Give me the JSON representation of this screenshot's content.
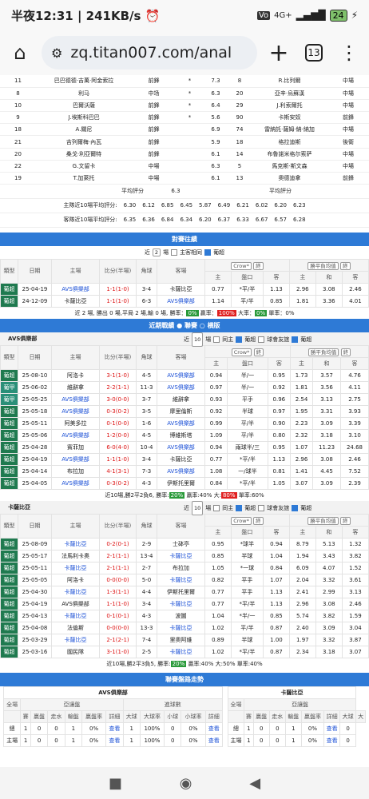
{
  "statusbar": {
    "time": "半夜12:31 | 241KB/s ⏰",
    "signal": "4G+",
    "battery": "24"
  },
  "browser": {
    "url": "zq.titan007.com/anal",
    "tab_count": "13"
  },
  "lineup": [
    [
      "11",
      "巴巴德德·吉萬·阿金索拉",
      "前鋒",
      "*",
      "7.3",
      "8",
      "R.比列爾",
      "中場"
    ],
    [
      "8",
      "利马",
      "中场",
      "*",
      "6.3",
      "20",
      "亞辛·烏蘇漢",
      "中場"
    ],
    [
      "10",
      "巴爾沃薩",
      "前鋒",
      "*",
      "6.4",
      "29",
      "J.利索爾托",
      "中場"
    ],
    [
      "9",
      "J.埃斯科巴巴",
      "前鋒",
      "*",
      "5.6",
      "90",
      "卡斯安奴",
      "前鋒"
    ],
    [
      "18",
      "A.關尼",
      "前鋒",
      "",
      "6.9",
      "74",
      "雷納託·薩姆·納·納加",
      "中場"
    ],
    [
      "21",
      "吉列爾梅·內瓦",
      "前鋒",
      "",
      "5.9",
      "18",
      "格拉迪斯",
      "後衛"
    ],
    [
      "20",
      "桑戈·利亞爾特",
      "前鋒",
      "",
      "6.1",
      "14",
      "布魯諾米格尔索萨",
      "中場"
    ],
    [
      "22",
      "G.文留卡",
      "中場",
      "",
      "6.3",
      "5",
      "馬克斯·斯文森",
      "中場"
    ],
    [
      "19",
      "T.加萊托",
      "中場",
      "",
      "6.1",
      "13",
      "奧德迪拿",
      "前鋒"
    ]
  ],
  "avg": {
    "label_left": "平均評分",
    "left_val": "6.3",
    "label_right": "平均評分",
    "home_label": "主隊近10場平均評分:",
    "home_vals": [
      "6.30",
      "6.12",
      "6.85",
      "6.45",
      "5.87",
      "6.49",
      "6.21",
      "6.02",
      "6.20",
      "6.23"
    ],
    "away_label": "客隊近10場平均評分:",
    "away_vals": [
      "6.35",
      "6.36",
      "6.84",
      "6.34",
      "6.20",
      "6.37",
      "6.33",
      "6.67",
      "6.57",
      "6.28"
    ]
  },
  "h2h": {
    "title": "對賽往績",
    "near": "近",
    "count": "2",
    "unit": "場",
    "same_home": "主客相同",
    "league": "葡超",
    "odds_company": "Crow*",
    "final": "終",
    "sub": "勝平負均值",
    "headers": [
      "類型",
      "日期",
      "主場",
      "比分(半場)",
      "角球",
      "客場",
      "主",
      "盤口",
      "客",
      "主",
      "和",
      "客"
    ],
    "rows": [
      [
        "葡超",
        "25-04-19",
        "AVS俱樂部",
        "1-1(1-0)",
        "3-4",
        "卡薩比亞",
        "0.77",
        "*平/半",
        "1.13",
        "2.96",
        "3.08",
        "2.46"
      ],
      [
        "葡超",
        "24-12-09",
        "卡薩比亞",
        "1-1(1-0)",
        "6-3",
        "AVS俱樂部",
        "1.14",
        "平/半",
        "0.85",
        "1.81",
        "3.36",
        "4.01"
      ]
    ],
    "summary_a": "近 2 場, 勝出 0 場,平局 2 場,輸 0 場, 勝率：",
    "win": "0%",
    "summary_b": "贏率：",
    "win2": "100%",
    "summary_c": "大率：",
    "win3": "0%",
    "summary_d": "單率：0%"
  },
  "recent": {
    "title": "近期戰績",
    "opt1": "聯賽",
    "opt2": "横版",
    "team1": "AVS俱樂部",
    "team1_near": "近",
    "team1_count": "10",
    "team1_unit": "場",
    "same": "同主",
    "league": "葡超",
    "cup": "球會友誼",
    "league2": "葡超",
    "headers": [
      "類型",
      "日期",
      "主場",
      "比分(半場)",
      "角球",
      "客場",
      "主",
      "盤口",
      "客",
      "主",
      "和",
      "客"
    ],
    "rows1": [
      [
        "葡超",
        "25-08-10",
        "阿洛卡",
        "3-1(1-0)",
        "4-5",
        "AVS俱樂部",
        "0.94",
        "半/一",
        "0.95",
        "1.73",
        "3.57",
        "4.76"
      ],
      [
        "葡甲",
        "25-06-02",
        "維辭拿",
        "2-2(1-1)",
        "11-3",
        "AVS俱樂部",
        "0.97",
        "半/一",
        "0.92",
        "1.81",
        "3.56",
        "4.11"
      ],
      [
        "葡甲",
        "25-05-25",
        "AVS俱樂部",
        "3-0(0-0)",
        "3-7",
        "維辭拿",
        "0.93",
        "平手",
        "0.96",
        "2.54",
        "3.13",
        "2.75"
      ],
      [
        "葡超",
        "25-05-18",
        "AVS俱樂部",
        "0-3(0-2)",
        "3-5",
        "摩里倫斯",
        "0.92",
        "半球",
        "0.97",
        "1.95",
        "3.31",
        "3.93"
      ],
      [
        "葡超",
        "25-05-11",
        "阿美多拉",
        "0-1(0-0)",
        "1-6",
        "AVS俱樂部",
        "0.99",
        "平/半",
        "0.90",
        "2.23",
        "3.09",
        "3.39"
      ],
      [
        "葡超",
        "25-05-06",
        "AVS俱樂部",
        "1-2(0-0)",
        "4-5",
        "博維斯塔",
        "1.09",
        "平/半",
        "0.80",
        "2.32",
        "3.18",
        "3.10"
      ],
      [
        "葡超",
        "25-04-28",
        "賓菲加",
        "6-0(4-0)",
        "10-4",
        "AVS俱樂部",
        "0.94",
        "兩球半/三",
        "0.95",
        "1.07",
        "11.23",
        "24.68"
      ],
      [
        "葡超",
        "25-04-19",
        "AVS俱樂部",
        "1-1(1-0)",
        "3-4",
        "卡薩比亞",
        "0.77",
        "*平/半",
        "1.13",
        "2.96",
        "3.08",
        "2.46"
      ],
      [
        "葡超",
        "25-04-14",
        "布拉加",
        "4-1(3-1)",
        "7-3",
        "AVS俱樂部",
        "1.08",
        "一/球半",
        "0.81",
        "1.41",
        "4.45",
        "7.52"
      ],
      [
        "葡超",
        "25-04-05",
        "AVS俱樂部",
        "0-3(0-2)",
        "4-3",
        "伊斯托里爾",
        "0.84",
        "*平/半",
        "1.05",
        "3.07",
        "3.09",
        "2.39"
      ]
    ],
    "summary1_a": "近10場,勝2平2負6, 勝率:",
    "summary1_win": "20%",
    "summary1_b": "贏率:40% 大:",
    "summary1_big": "80%",
    "summary1_c": "單率:60%",
    "team2": "卡薩比亞",
    "team2_near": "近",
    "team2_count": "10",
    "team2_unit": "場",
    "rows2": [
      [
        "葡超",
        "25-08-09",
        "卡薩比亞",
        "0-2(0-1)",
        "2-9",
        "士砵亭",
        "0.95",
        "*球半",
        "0.94",
        "8.79",
        "5.13",
        "1.32"
      ],
      [
        "葡超",
        "25-05-17",
        "法馬利卡奧",
        "2-1(1-1)",
        "13-4",
        "卡薩比亞",
        "0.85",
        "半球",
        "1.04",
        "1.94",
        "3.43",
        "3.82"
      ],
      [
        "葡超",
        "25-05-11",
        "卡薩比亞",
        "2-1(1-1)",
        "2-7",
        "布拉加",
        "1.05",
        "*一球",
        "0.84",
        "6.09",
        "4.07",
        "1.52"
      ],
      [
        "葡超",
        "25-05-05",
        "阿洛卡",
        "0-0(0-0)",
        "5-0",
        "卡薩比亞",
        "0.82",
        "平手",
        "1.07",
        "2.04",
        "3.32",
        "3.61"
      ],
      [
        "葡超",
        "25-04-30",
        "卡薩比亞",
        "1-3(1-1)",
        "4-4",
        "伊斯托里爾",
        "0.77",
        "平手",
        "1.13",
        "2.41",
        "2.99",
        "3.13"
      ],
      [
        "葡超",
        "25-04-19",
        "AVS俱樂部",
        "1-1(1-0)",
        "3-4",
        "卡薩比亞",
        "0.77",
        "*平/半",
        "1.13",
        "2.96",
        "3.08",
        "2.46"
      ],
      [
        "葡超",
        "25-04-13",
        "卡薩比亞",
        "0-1(0-1)",
        "4-3",
        "波圖",
        "1.04",
        "*半/一",
        "0.85",
        "5.74",
        "3.82",
        "1.59"
      ],
      [
        "葡超",
        "25-04-08",
        "法倫斯",
        "0-0(0-0)",
        "13-3",
        "卡薩比亞",
        "1.02",
        "平/半",
        "0.87",
        "2.40",
        "3.09",
        "3.04"
      ],
      [
        "葡超",
        "25-03-29",
        "卡薩比亞",
        "2-1(2-1)",
        "7-4",
        "里奧阿維",
        "0.89",
        "半球",
        "1.00",
        "1.97",
        "3.32",
        "3.87"
      ],
      [
        "葡超",
        "25-03-16",
        "國民隊",
        "3-1(1-0)",
        "2-5",
        "卡薩比亞",
        "1.02",
        "*平/半",
        "0.87",
        "2.34",
        "3.18",
        "3.07"
      ]
    ],
    "summary2_a": "近10場,勝2平3負5, 勝率:",
    "summary2_win": "20%",
    "summary2_b": "贏率:40% 大:50% 單率:40%"
  },
  "trend": {
    "title": "聯賽盤路走勢",
    "left_team": "AVS俱樂部",
    "right_team": "卡薩比亞",
    "head1": [
      "全場",
      "亞讓盤",
      "進球數"
    ],
    "head1r": [
      "全場",
      "亞讓盤"
    ],
    "cols": [
      "賽",
      "贏盤",
      "走水",
      "輸盤",
      "贏盤率",
      "詳細",
      "大球",
      "大球率",
      "小球",
      "小球率",
      "詳細"
    ],
    "colsr": [
      "賽",
      "贏盤",
      "走水",
      "輸盤",
      "贏盤率",
      "詳細",
      "大球",
      "大"
    ],
    "row_total": [
      "總",
      "1",
      "0",
      "0",
      "1",
      "0%",
      "查看",
      "1",
      "100%",
      "0",
      "0%",
      "查看"
    ],
    "row_total_r": [
      "總",
      "1",
      "0",
      "0",
      "1",
      "0%",
      "查看",
      "0"
    ],
    "row_home": [
      "主場",
      "1",
      "0",
      "0",
      "1",
      "0%",
      "查看",
      "1",
      "100%",
      "0",
      "0%",
      "查看"
    ],
    "row_home_r": [
      "主場",
      "1",
      "0",
      "0",
      "1",
      "0%",
      "查看",
      "0"
    ]
  }
}
